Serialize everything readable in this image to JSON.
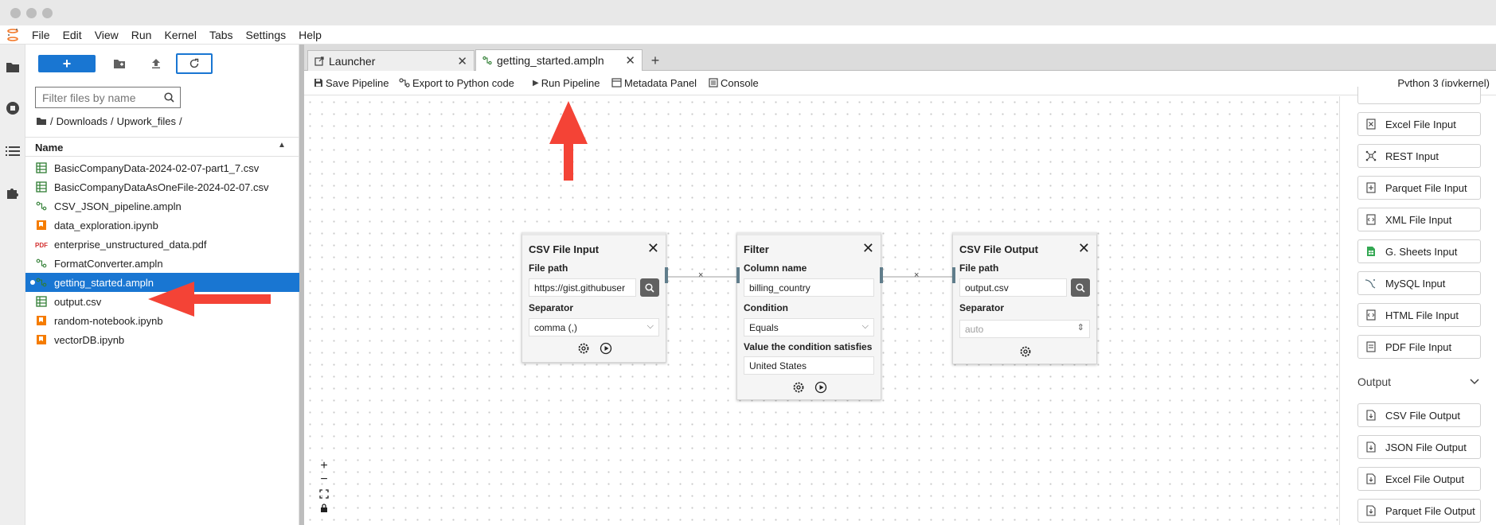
{
  "window": {
    "controls": [
      "close",
      "minimize",
      "maximize"
    ]
  },
  "menu": {
    "items": [
      "File",
      "Edit",
      "View",
      "Run",
      "Kernel",
      "Tabs",
      "Settings",
      "Help"
    ]
  },
  "filebrowser": {
    "new_label": "+",
    "search_placeholder": "Filter files by name",
    "breadcrumb": [
      "/",
      "Downloads",
      "/",
      "Upwork_files",
      "/"
    ],
    "column_header": "Name",
    "files": [
      {
        "name": "BasicCompanyData-2024-02-07-part1_7.csv",
        "icon": "csv-icon"
      },
      {
        "name": "BasicCompanyDataAsOneFile-2024-02-07.csv",
        "icon": "csv-icon"
      },
      {
        "name": "CSV_JSON_pipeline.ampln",
        "icon": "pipeline-icon"
      },
      {
        "name": "data_exploration.ipynb",
        "icon": "notebook-icon"
      },
      {
        "name": "enterprise_unstructured_data.pdf",
        "icon": "pdf-icon"
      },
      {
        "name": "FormatConverter.ampln",
        "icon": "pipeline-icon"
      },
      {
        "name": "getting_started.ampln",
        "icon": "pipeline-icon",
        "selected": true
      },
      {
        "name": "output.csv",
        "icon": "csv-icon"
      },
      {
        "name": "random-notebook.ipynb",
        "icon": "notebook-icon"
      },
      {
        "name": "vectorDB.ipynb",
        "icon": "notebook-icon"
      }
    ]
  },
  "tabs": [
    {
      "label": "Launcher",
      "active": false
    },
    {
      "label": "getting_started.ampln",
      "active": true
    }
  ],
  "toolbar": {
    "save": "Save Pipeline",
    "export": "Export to Python code",
    "run": "Run Pipeline",
    "metadata": "Metadata Panel",
    "console": "Console",
    "kernel": "Python 3 (ipykernel)"
  },
  "nodes": {
    "csv_input": {
      "title": "CSV File Input",
      "file_path_label": "File path",
      "file_path_value": "https://gist.githubuser",
      "separator_label": "Separator",
      "separator_value": "comma (,)"
    },
    "filter": {
      "title": "Filter",
      "column_label": "Column name",
      "column_value": "billing_country",
      "condition_label": "Condition",
      "condition_value": "Equals",
      "satisfies_label": "Value the condition satisfies",
      "satisfies_value": "United States"
    },
    "csv_output": {
      "title": "CSV File Output",
      "file_path_label": "File path",
      "file_path_value": "output.csv",
      "separator_label": "Separator",
      "separator_value": "auto"
    }
  },
  "edge_marker": "×",
  "palette": {
    "input_items": [
      {
        "label": "Excel File Input",
        "icon": "excel-icon"
      },
      {
        "label": "REST Input",
        "icon": "rest-icon"
      },
      {
        "label": "Parquet File Input",
        "icon": "parquet-icon"
      },
      {
        "label": "XML File Input",
        "icon": "xml-icon"
      },
      {
        "label": "G. Sheets Input",
        "icon": "sheets-icon"
      },
      {
        "label": "MySQL Input",
        "icon": "mysql-icon"
      },
      {
        "label": "HTML File Input",
        "icon": "html-icon"
      },
      {
        "label": "PDF File Input",
        "icon": "pdf-icon"
      }
    ],
    "output_section": "Output",
    "output_items": [
      {
        "label": "CSV File Output",
        "icon": "file-icon"
      },
      {
        "label": "JSON File Output",
        "icon": "file-icon"
      },
      {
        "label": "Excel File Output",
        "icon": "file-icon"
      },
      {
        "label": "Parquet File Output",
        "icon": "file-icon"
      }
    ]
  },
  "colors": {
    "accent": "#1976d2",
    "selection": "#1976d2",
    "annotation_arrow": "#f44336",
    "node_action": "#616161"
  }
}
